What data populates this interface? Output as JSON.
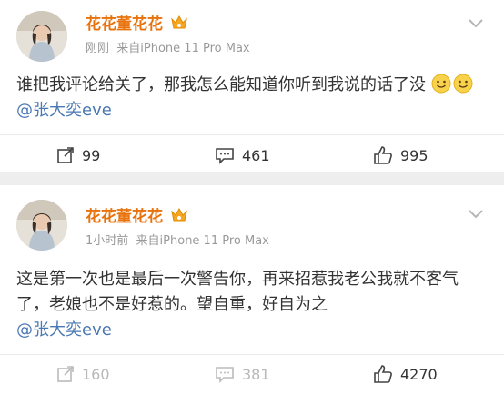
{
  "posts": [
    {
      "username": "花花董花花",
      "time": "刚刚",
      "source": "来自iPhone 11 Pro Max",
      "content_main": "谁把我评论给关了，那我怎么能知道你听到我说的话了没",
      "mention": "@张大奕eve",
      "reposts": "99",
      "comments": "461",
      "likes": "995"
    },
    {
      "username": "花花董花花",
      "time": "1小时前",
      "source": "来自iPhone 11 Pro Max",
      "content_main": "这是第一次也是最后一次警告你，再来招惹我老公我就不客气了，老娘也不是好惹的。望自重，好自为之",
      "mention": "@张大奕eve",
      "reposts": "160",
      "comments": "381",
      "likes": "4270"
    }
  ],
  "colors": {
    "username": "#e8730c",
    "mention": "#4a78b3",
    "meta": "#999999",
    "muted": "#b8b8b8"
  }
}
